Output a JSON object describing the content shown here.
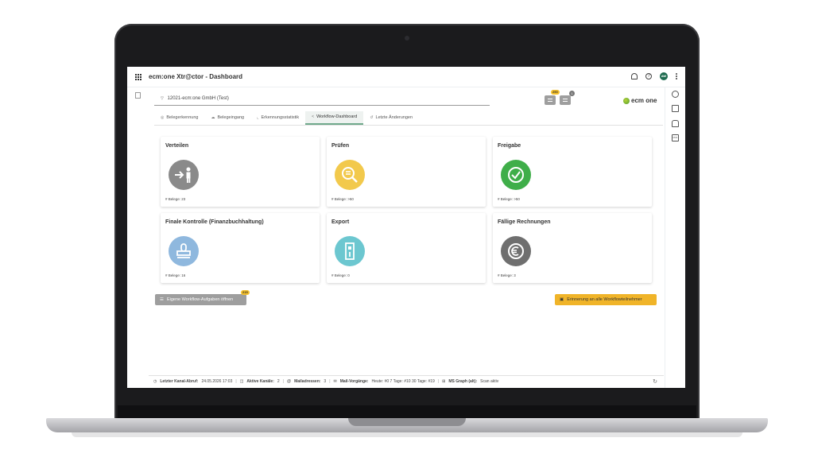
{
  "app": {
    "title": "ecm:one Xtr@ctor - Dashboard",
    "avatar_initials": "AW"
  },
  "mandant": "12021-ecm:one GmbH (Test)",
  "queues": {
    "badge1": "290",
    "badge2": "1"
  },
  "brand": {
    "text": "ecm one"
  },
  "tabs": [
    {
      "label": "Belegerkennung",
      "icon": "check-circle-icon"
    },
    {
      "label": "Belegeingang",
      "icon": "cloud-icon"
    },
    {
      "label": "Erkennungsstatistik",
      "icon": "chart-icon"
    },
    {
      "label": "Workflow-Dashboard",
      "icon": "share-icon"
    },
    {
      "label": "Letzte Änderungen",
      "icon": "history-icon"
    }
  ],
  "cards": [
    {
      "title": "Verteilen",
      "count": "# Belege: 23",
      "color": "#8a8a8a",
      "icon": "person-arrow-icon"
    },
    {
      "title": "Prüfen",
      "count": "# Belege: >50",
      "color": "#f2c94c",
      "icon": "search-document-icon"
    },
    {
      "title": "Freigabe",
      "count": "# Belege: >50",
      "color": "#3fae49",
      "icon": "check-icon"
    },
    {
      "title": "Finale Kontrolle (Finanzbuchhaltung)",
      "count": "# Belege: 16",
      "color": "#8fb8de",
      "icon": "stamp-icon"
    },
    {
      "title": "Export",
      "count": "# Belege: 0",
      "color": "#6cc7d0",
      "icon": "export-icon"
    },
    {
      "title": "Fällige Rechnungen",
      "count": "# Belege: 3",
      "color": "#6f6f6f",
      "icon": "euro-icon"
    }
  ],
  "buttons": {
    "own_tasks": "Eigene Workflow-Aufgaben öffnen",
    "own_tasks_badge": "215",
    "remind_all": "Erinnerung an alle Workflowteilnehmer"
  },
  "status": {
    "last_fetch_label": "Letzter Kanal-Abruf:",
    "last_fetch_value": "24.05.2026 17:03",
    "channels_label": "Aktive Kanäle:",
    "channels_value": "2",
    "mail_label": "Mailadressen:",
    "mail_value": "3",
    "processes_label": "Mail-Vorgänge:",
    "processes_value": "Heute: #0   7 Tage: #10   30 Tage: #19",
    "msgraph_label": "MS Graph (alt):",
    "msgraph_value": "Scan aktiv"
  }
}
